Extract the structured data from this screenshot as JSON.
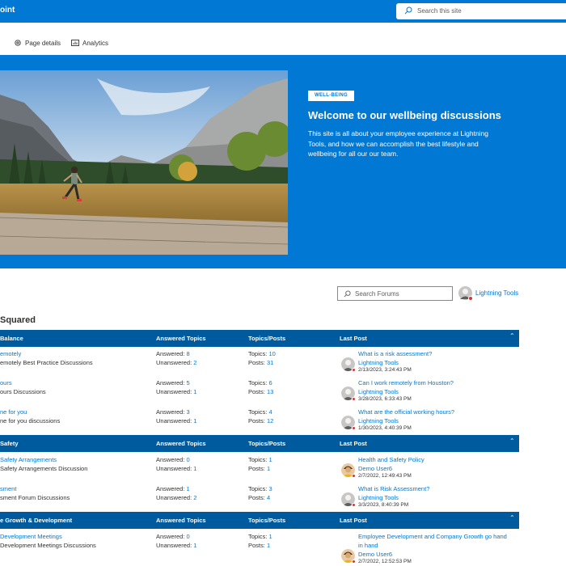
{
  "suite": {
    "brand_fragment": "oint",
    "search_placeholder": "Search this site"
  },
  "commands": {
    "page_details": "Page details",
    "analytics": "Analytics"
  },
  "hero": {
    "badge": "WELL-BEING",
    "title": "Welcome to our wellbeing discussions",
    "description": "This site is all about your employee experience at Lightning Tools, and how we can accomplish the best lifestyle and wellbeing for all our our team."
  },
  "forum_toolbar": {
    "search_placeholder": "Search Forums",
    "user_name": "Lightning Tools"
  },
  "section_title": "Squared",
  "categories": [
    {
      "name": "Balance",
      "col_topics": "Answered Topics",
      "col_posts": "Topics/Posts",
      "col_last": "Last Post",
      "forums": [
        {
          "title": "emotely",
          "desc": "emotely Best Practice Discussions",
          "answered_label": "Answered:",
          "answered": "8",
          "unanswered_label": "Unanswered:",
          "unanswered": "2",
          "topics_label": "Topics:",
          "topics": "10",
          "posts_label": "Posts:",
          "posts": "31",
          "last_title": "What is a risk assessment?",
          "last_user": "Lightning Tools",
          "last_date": "2/13/2023, 3:24:43 PM",
          "avatar": "gray"
        },
        {
          "title": "ours",
          "desc": "ours Discussions",
          "answered_label": "Answered:",
          "answered": "5",
          "unanswered_label": "Unanswered:",
          "unanswered": "1",
          "topics_label": "Topics:",
          "topics": "6",
          "posts_label": "Posts:",
          "posts": "13",
          "last_title": "Can I work remotely from Houston?",
          "last_user": "Lightning Tools",
          "last_date": "3/28/2023, 6:33:43 PM",
          "avatar": "gray"
        },
        {
          "title": "ne for you",
          "desc": "ne for you discussions",
          "answered_label": "Answered:",
          "answered": "3",
          "unanswered_label": "Unanswered:",
          "unanswered": "1",
          "topics_label": "Topics:",
          "topics": "4",
          "posts_label": "Posts:",
          "posts": "12",
          "last_title": "What are the official working hours?",
          "last_user": "Lightning Tools",
          "last_date": "1/30/2023, 4:40:39 PM",
          "avatar": "gray"
        }
      ]
    },
    {
      "name": "Safety",
      "col_topics": "Answered Topics",
      "col_posts": "Topics/Posts",
      "col_last": "Last Post",
      "forums": [
        {
          "title": "Safety Arrangements",
          "desc": "Safety Arrangements Discussion",
          "answered_label": "Answered:",
          "answered": "0",
          "unanswered_label": "Unanswered:",
          "unanswered": "1",
          "topics_label": "Topics:",
          "topics": "1",
          "posts_label": "Posts:",
          "posts": "1",
          "last_title": "Health and Safety Policy",
          "last_user": "Demo User6",
          "last_date": "2/7/2022, 12:49:43 PM",
          "avatar": "demo"
        },
        {
          "title": "sment",
          "desc": "sment Forum Discussions",
          "answered_label": "Answered:",
          "answered": "1",
          "unanswered_label": "Unanswered:",
          "unanswered": "2",
          "topics_label": "Topics:",
          "topics": "3",
          "posts_label": "Posts:",
          "posts": "4",
          "last_title": "What is Risk Assessment?",
          "last_user": "Lightning Tools",
          "last_date": "3/3/2023, 8:40:39 PM",
          "avatar": "gray"
        }
      ]
    },
    {
      "name": "e Growth & Development",
      "col_topics": "Answered Topics",
      "col_posts": "Topics/Posts",
      "col_last": "Last Post",
      "forums": [
        {
          "title": "Development Meetings",
          "desc": "Development Meetings Discussions",
          "answered_label": "Answered:",
          "answered": "0",
          "unanswered_label": "Unanswered:",
          "unanswered": "1",
          "topics_label": "Topics:",
          "topics": "1",
          "posts_label": "Posts:",
          "posts": "1",
          "last_title": "Employee Development and Company Growth go hand",
          "last_title_2": "in hand",
          "last_user": "Demo User6",
          "last_date": "2/7/2022, 12:52:53 PM",
          "avatar": "demo"
        }
      ]
    }
  ],
  "colors": {
    "brand": "#0078d4",
    "table_header": "#005a9e",
    "presence": "#d13438"
  }
}
